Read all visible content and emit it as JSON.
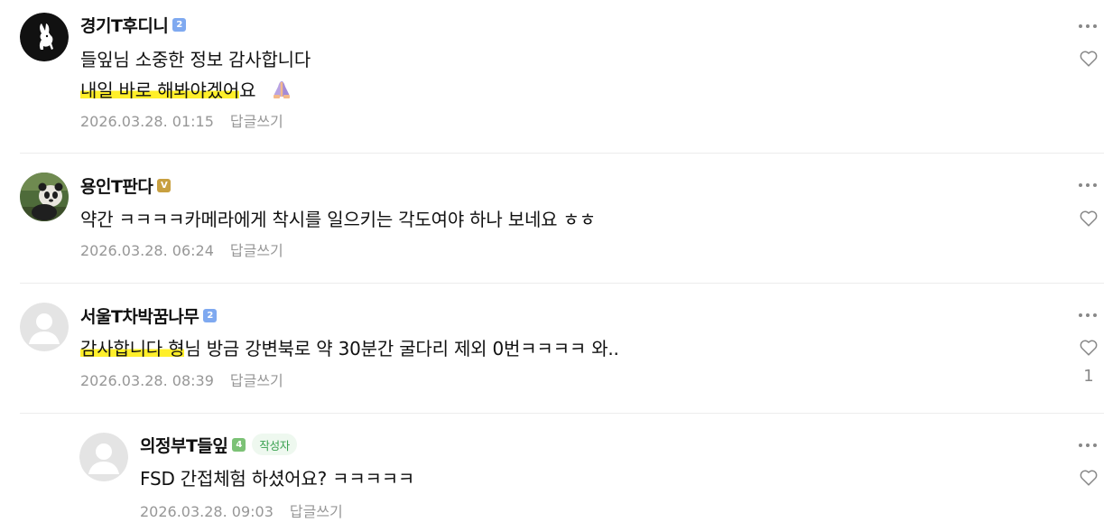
{
  "comments": [
    {
      "author": "경기T후디니",
      "badge": "2",
      "text_line1": "들잎님 소중한 정보 감사합니다",
      "text_line2_highlight": "내일 바로 해봐야겠어",
      "text_line2_rest": "요",
      "emoji": "🙏",
      "date": "2026.03.28. 01:15",
      "reply_label": "답글쓰기"
    },
    {
      "author": "용인T판다",
      "badge": "V",
      "text": "약간 ㅋㅋㅋㅋ카메라에게 착시를 일으키는 각도여야 하나 보네요 ㅎㅎ",
      "date": "2026.03.28. 06:24",
      "reply_label": "답글쓰기"
    },
    {
      "author": "서울T차박꿈나무",
      "badge": "2",
      "text_highlight": "감사합니다 형",
      "text_rest": "님 방금 강변북로 약 30분간 굴다리 제외 0번ㅋㅋㅋㅋ 와..",
      "date": "2026.03.28. 08:39",
      "reply_label": "답글쓰기",
      "like_count": "1"
    },
    {
      "author": "의정부T들잎",
      "badge": "4",
      "author_tag": "작성자",
      "text": "FSD 간접체험 하셨어요? ㅋㅋㅋㅋㅋ",
      "date": "2026.03.28. 09:03",
      "reply_label": "답글쓰기"
    }
  ],
  "colors": {
    "highlight": "#ffef2a",
    "meta_text": "#979797",
    "badge_blue": "#7fa9f0",
    "badge_gold": "#c8a040",
    "badge_green": "#7cc276",
    "author_tag_text": "#3aa150"
  },
  "icons": [
    "more-icon",
    "heart-icon",
    "prayer-hands-emoji",
    "playboy-bunny-avatar",
    "panda-avatar",
    "default-avatar"
  ]
}
